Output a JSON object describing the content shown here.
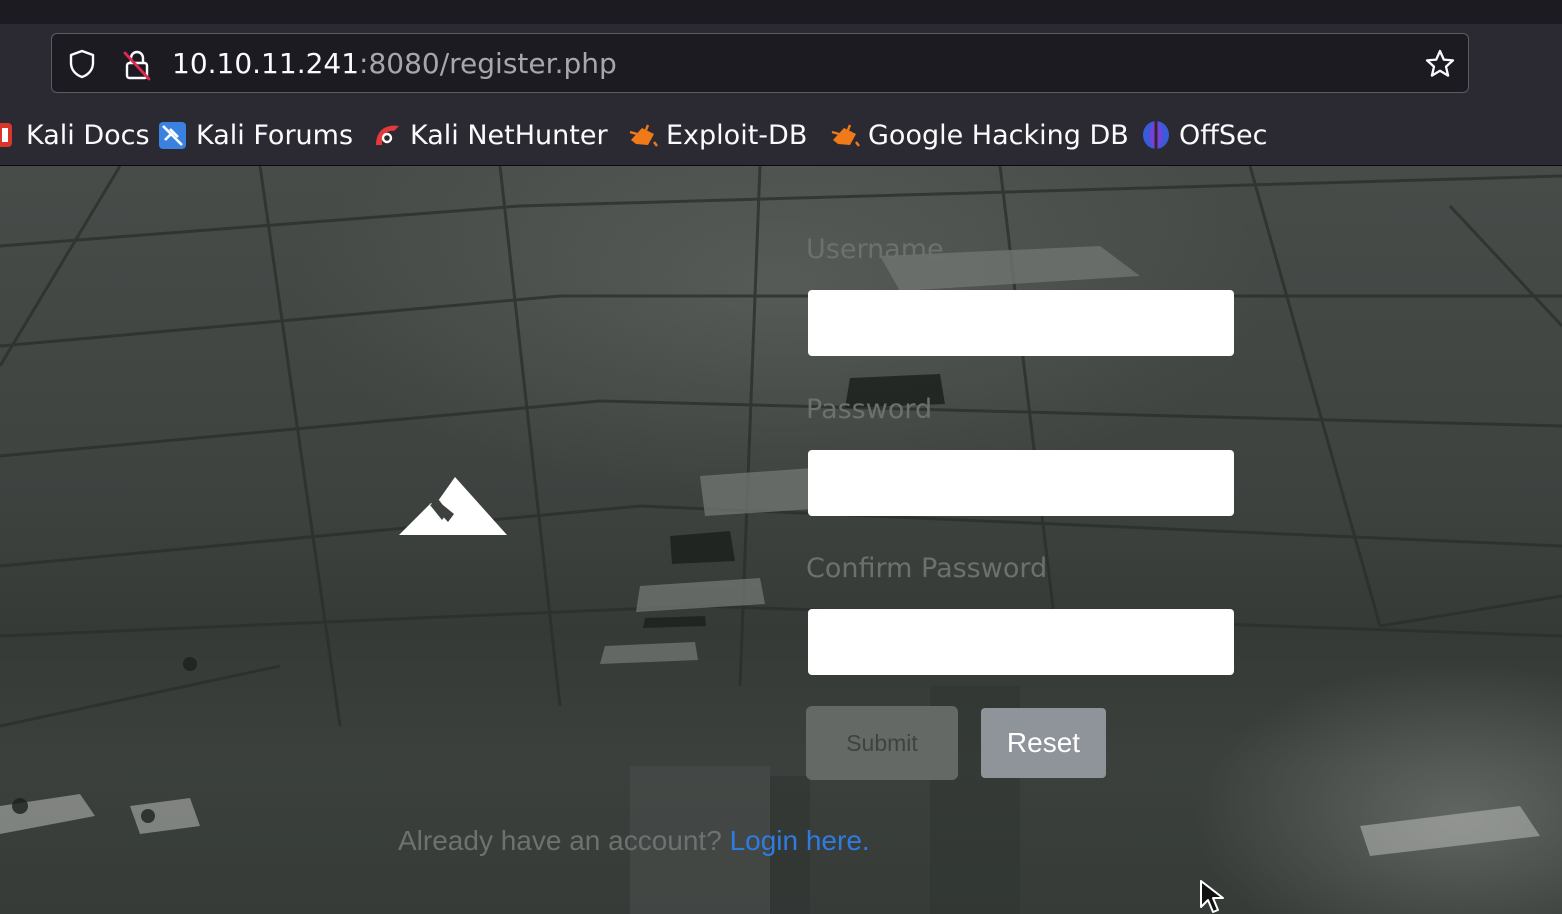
{
  "browser": {
    "url_host": "10.10.11.241",
    "url_rest": ":8080/register.php",
    "bookmarks": [
      {
        "label": "Kali Docs"
      },
      {
        "label": "Kali Forums"
      },
      {
        "label": "Kali NetHunter"
      },
      {
        "label": "Exploit-DB"
      },
      {
        "label": "Google Hacking DB"
      },
      {
        "label": "OffSec"
      }
    ]
  },
  "form": {
    "username_label": "Username",
    "password_label": "Password",
    "confirm_label": "Confirm Password",
    "submit_label": "Submit",
    "reset_label": "Reset",
    "login_prompt": "Already have an account?",
    "login_link": "Login here",
    "login_suffix": "."
  },
  "colors": {
    "link": "#2f7be0",
    "reset_button": "#8f949b",
    "submit_button": "#646966"
  }
}
